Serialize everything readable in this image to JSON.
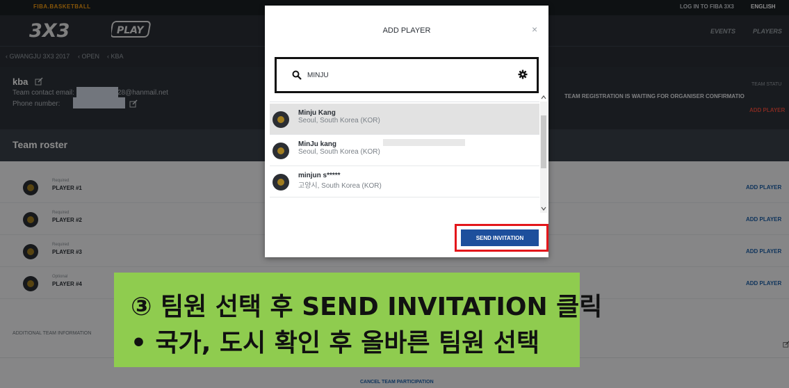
{
  "topbar": {
    "brand": "FIBA.BASKETBALL",
    "login": "LOG IN TO FIBA 3X3",
    "language": "ENGLISH"
  },
  "header": {
    "logo": "3X3",
    "play_logo": "PLAY",
    "nav": [
      "EVENTS",
      "PLAYERS"
    ]
  },
  "breadcrumb": [
    "‹ GWANGJU 3X3 2017",
    "‹ OPEN",
    "‹ KBA"
  ],
  "team": {
    "name": "kba",
    "contact_label": "Team contact email:",
    "contact_value": "28@hanmail.net",
    "phone_label": "Phone number:",
    "phone_value": ")",
    "status_label": "TEAM STATU",
    "status_text": "TEAM REGISTRATION IS WAITING FOR ORGANISER CONFIRMATIO",
    "add_player": "ADD PLAYER"
  },
  "roster": {
    "title": "Team roster",
    "rows": [
      {
        "requirement": "Required",
        "label": "PLAYER #1",
        "action": "ADD PLAYER"
      },
      {
        "requirement": "Required",
        "label": "PLAYER #2",
        "action": "ADD PLAYER"
      },
      {
        "requirement": "Required",
        "label": "PLAYER #3",
        "action": "ADD PLAYER"
      },
      {
        "requirement": "Optional",
        "label": "PLAYER #4",
        "action": "ADD PLAYER"
      }
    ],
    "additional_info": "ADDITIONAL TEAM INFORMATION",
    "cancel": "CANCEL TEAM PARTICIPATION"
  },
  "modal": {
    "title": "ADD PLAYER",
    "close": "×",
    "search_value": "MINJU",
    "results": [
      {
        "name": "Minju Kang",
        "location": "Seoul, South Korea (KOR)"
      },
      {
        "name": "MinJu kang",
        "location": "Seoul, South Korea (KOR)"
      },
      {
        "name": "minjun s*****",
        "location": "고양시, South Korea (KOR)"
      }
    ],
    "send_button": "SEND INVITATION"
  },
  "caption": {
    "line1": "③ 팀원 선택 후 SEND INVITATION 클릭",
    "line2": "•   국가, 도시 확인 후 올바른 팀원 선택"
  },
  "colors": {
    "accent": "#1d4f9c",
    "highlight": "#e3161b",
    "caption_bg": "#8fcc4f"
  }
}
